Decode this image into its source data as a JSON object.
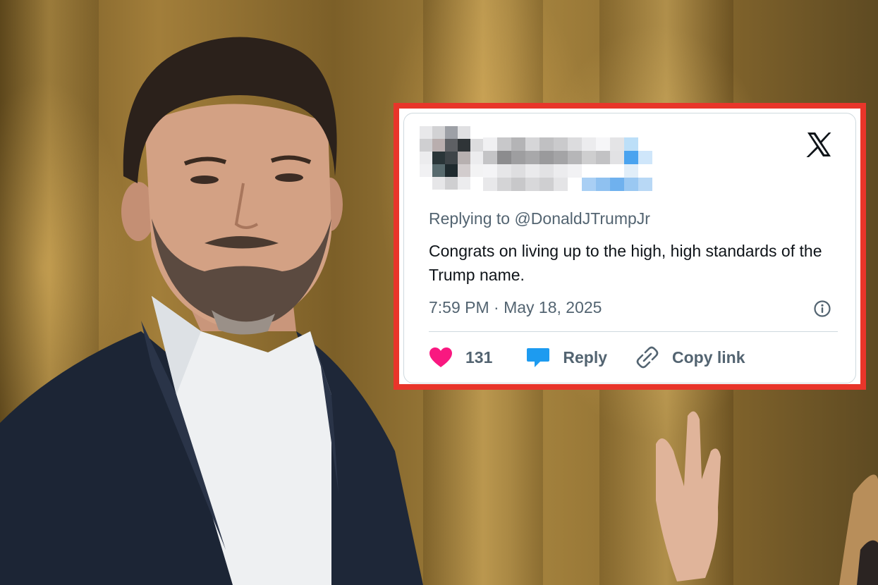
{
  "tweet": {
    "logo": "x-logo",
    "replying_to": "Replying to @DonaldJTrumpJr",
    "text": "Congrats on living up to the high, high standards of the Trump name.",
    "timestamp": "7:59 PM · May 18, 2025",
    "info_icon": "info-icon",
    "actions": {
      "like": {
        "icon": "heart-icon",
        "count": "131",
        "color": "#f91880"
      },
      "reply": {
        "icon": "speech-bubble-icon",
        "label": "Reply",
        "color": "#1d9bf0"
      },
      "copy": {
        "icon": "link-icon",
        "label": "Copy link"
      }
    }
  },
  "colors": {
    "frame_border": "#e8352a",
    "secondary_text": "#536471",
    "primary_text": "#0f1419"
  }
}
